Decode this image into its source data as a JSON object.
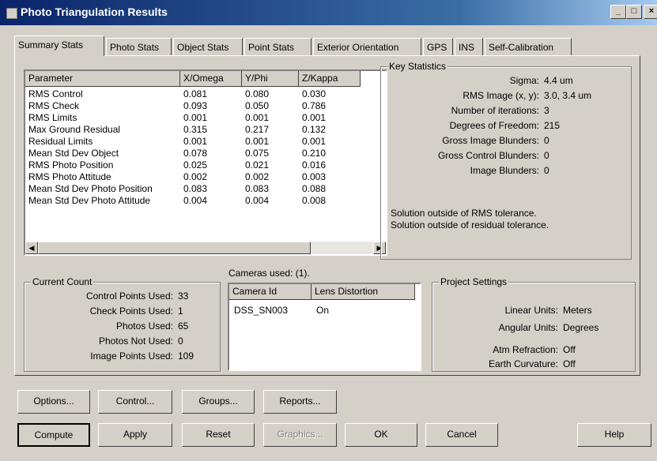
{
  "window": {
    "title": "Photo Triangulation Results",
    "minimize": "_",
    "maximize": "□",
    "close": "×"
  },
  "tabs": [
    "Summary Stats",
    "Photo Stats",
    "Object Stats",
    "Point Stats",
    "Exterior Orientation",
    "GPS",
    "INS",
    "Self-Calibration"
  ],
  "stats_table": {
    "headers": [
      "Parameter",
      "X/Omega",
      "Y/Phi",
      "Z/Kappa"
    ],
    "rows": [
      [
        "RMS Control",
        "0.081",
        "0.080",
        "0.030"
      ],
      [
        "RMS Check",
        "0.093",
        "0.050",
        "0.786"
      ],
      [
        "RMS Limits",
        "0.001",
        "0.001",
        "0.001"
      ],
      [
        "Max Ground Residual",
        "0.315",
        "0.217",
        "0.132"
      ],
      [
        "Residual Limits",
        "0.001",
        "0.001",
        "0.001"
      ],
      [
        "Mean Std Dev Object",
        "0.078",
        "0.075",
        "0.210"
      ],
      [
        "RMS Photo Position",
        "0.025",
        "0.021",
        "0.016"
      ],
      [
        "RMS Photo Attitude",
        "0.002",
        "0.002",
        "0.003"
      ],
      [
        "Mean Std Dev Photo Position",
        "0.083",
        "0.083",
        "0.088"
      ],
      [
        "Mean Std Dev Photo Attitude",
        "0.004",
        "0.004",
        "0.008"
      ]
    ]
  },
  "key_statistics": {
    "label": "Key Statistics",
    "items": [
      {
        "label": "Sigma:",
        "value": "4.4  um"
      },
      {
        "label": "RMS Image (x, y):",
        "value": "3.0,  3.4  um"
      },
      {
        "label": "Number of iterations:",
        "value": "3"
      },
      {
        "label": "Degrees of Freedom:",
        "value": "215"
      },
      {
        "label": "Gross Image Blunders:",
        "value": "0"
      },
      {
        "label": "Gross Control Blunders:",
        "value": "0"
      },
      {
        "label": "Image Blunders:",
        "value": "0"
      }
    ],
    "messages": [
      "Solution outside of RMS tolerance.",
      "Solution outside of residual tolerance."
    ]
  },
  "current_count": {
    "label": "Current Count",
    "items": [
      {
        "label": "Control Points Used:",
        "value": "33"
      },
      {
        "label": "Check Points Used:",
        "value": "1"
      },
      {
        "label": "Photos Used:",
        "value": "65"
      },
      {
        "label": "Photos Not Used:",
        "value": "0"
      },
      {
        "label": "Image Points Used:",
        "value": "109"
      }
    ]
  },
  "cameras": {
    "label": "Cameras used: (1).",
    "headers": [
      "Camera Id",
      "Lens Distortion"
    ],
    "rows": [
      [
        "DSS_SN003",
        "On"
      ]
    ]
  },
  "project_settings": {
    "label": "Project Settings",
    "items": [
      {
        "label": "Linear Units:",
        "value": "Meters"
      },
      {
        "label": "Angular Units:",
        "value": "Degrees"
      },
      {
        "label": "Atm Refraction:",
        "value": "Off"
      },
      {
        "label": "Earth Curvature:",
        "value": "Off"
      }
    ]
  },
  "buttons_row1": [
    "Options...",
    "Control...",
    "Groups...",
    "Reports..."
  ],
  "buttons_row2": [
    "Compute",
    "Apply",
    "Reset",
    "Graphics...",
    "OK",
    "Cancel",
    "Help"
  ]
}
